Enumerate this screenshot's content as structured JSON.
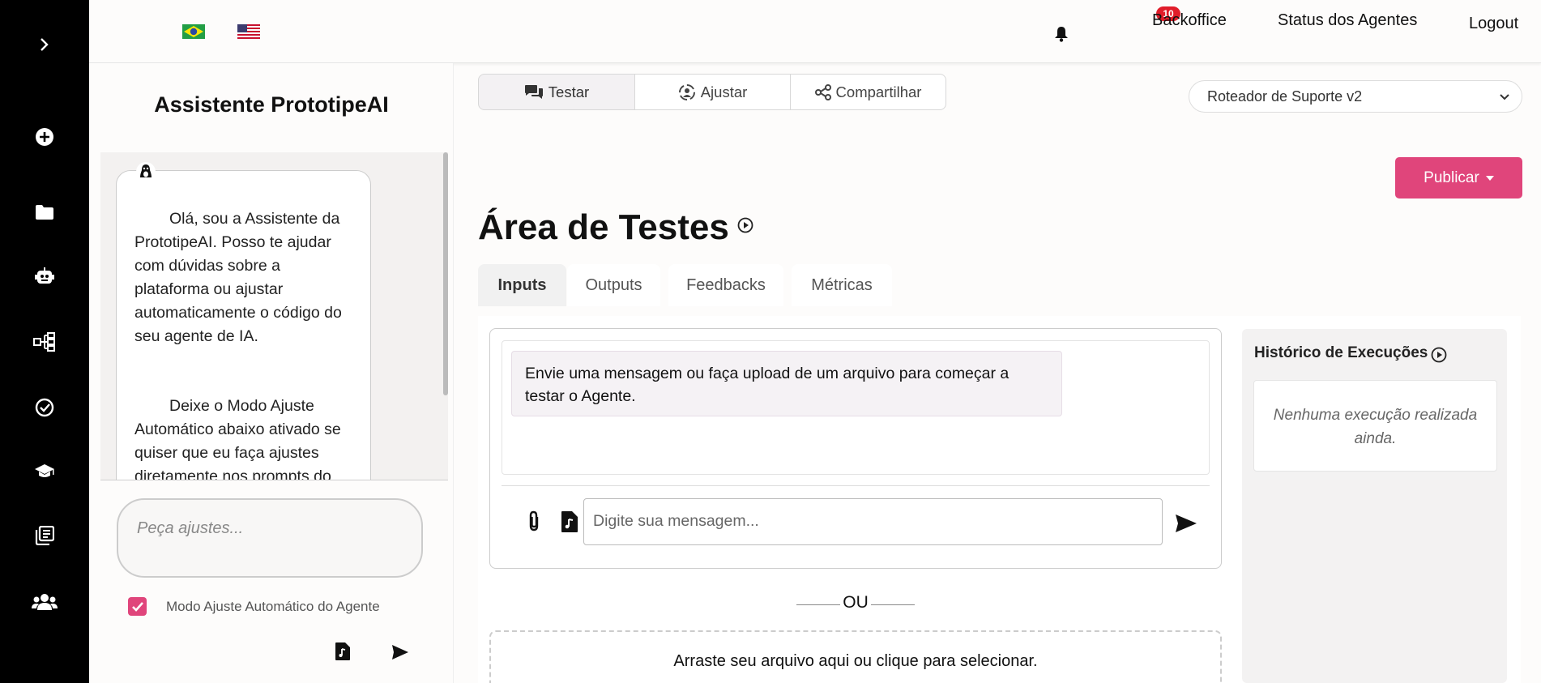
{
  "rail": {
    "items": [
      {
        "icon": "chevron-right-icon"
      },
      {
        "icon": "plus-circle-icon"
      },
      {
        "icon": "folder-icon"
      },
      {
        "icon": "robot-icon"
      },
      {
        "icon": "workflow-icon"
      },
      {
        "icon": "check-circle-icon"
      },
      {
        "icon": "graduation-cap-icon"
      },
      {
        "icon": "book-icon"
      },
      {
        "icon": "users-icon"
      }
    ]
  },
  "header": {
    "languages": [
      {
        "icon": "brazil-flag-icon"
      },
      {
        "icon": "us-flag-icon"
      }
    ],
    "notification_count": "10",
    "links": [
      "Backoffice",
      "Status dos Agentes",
      "Logout"
    ]
  },
  "assistant": {
    "title": "Assistente PrototipeAI",
    "messages": [
      "Olá, sou a Assistente da PrototipeAI. Posso te ajudar com dúvidas sobre a plataforma ou ajustar automaticamente o código do seu agente de IA.",
      "Deixe o Modo Ajuste Automático abaixo ativado se quiser que eu faça ajustes diretamente nos prompts do"
    ],
    "input_placeholder": "Peça ajustes...",
    "auto_mode_label": "Modo Ajuste Automático do Agente",
    "auto_mode_checked": true
  },
  "toolbar": {
    "tabs": [
      "Testar",
      "Ajustar",
      "Compartilhar"
    ],
    "active": "Testar"
  },
  "agent_select": {
    "value": "Roteador de Suporte v2"
  },
  "publish_label": "Publicar",
  "test_area": {
    "title": "Área de Testes",
    "tabs": [
      "Inputs",
      "Outputs",
      "Feedbacks",
      "Métricas"
    ],
    "active_tab": "Inputs",
    "system_message": "Envie uma mensagem ou faça upload de um arquivo para começar a testar o Agente.",
    "input_placeholder": "Digite sua mensagem...",
    "or_label": "OU",
    "drop_label": "Arraste seu arquivo aqui ou clique para selecionar."
  },
  "history": {
    "title": "Histórico de Execuções",
    "empty": "Nenhuma execução realizada ainda."
  },
  "colors": {
    "accent": "#e0457b",
    "badge": "#e11d2a",
    "rail": "#000000"
  }
}
